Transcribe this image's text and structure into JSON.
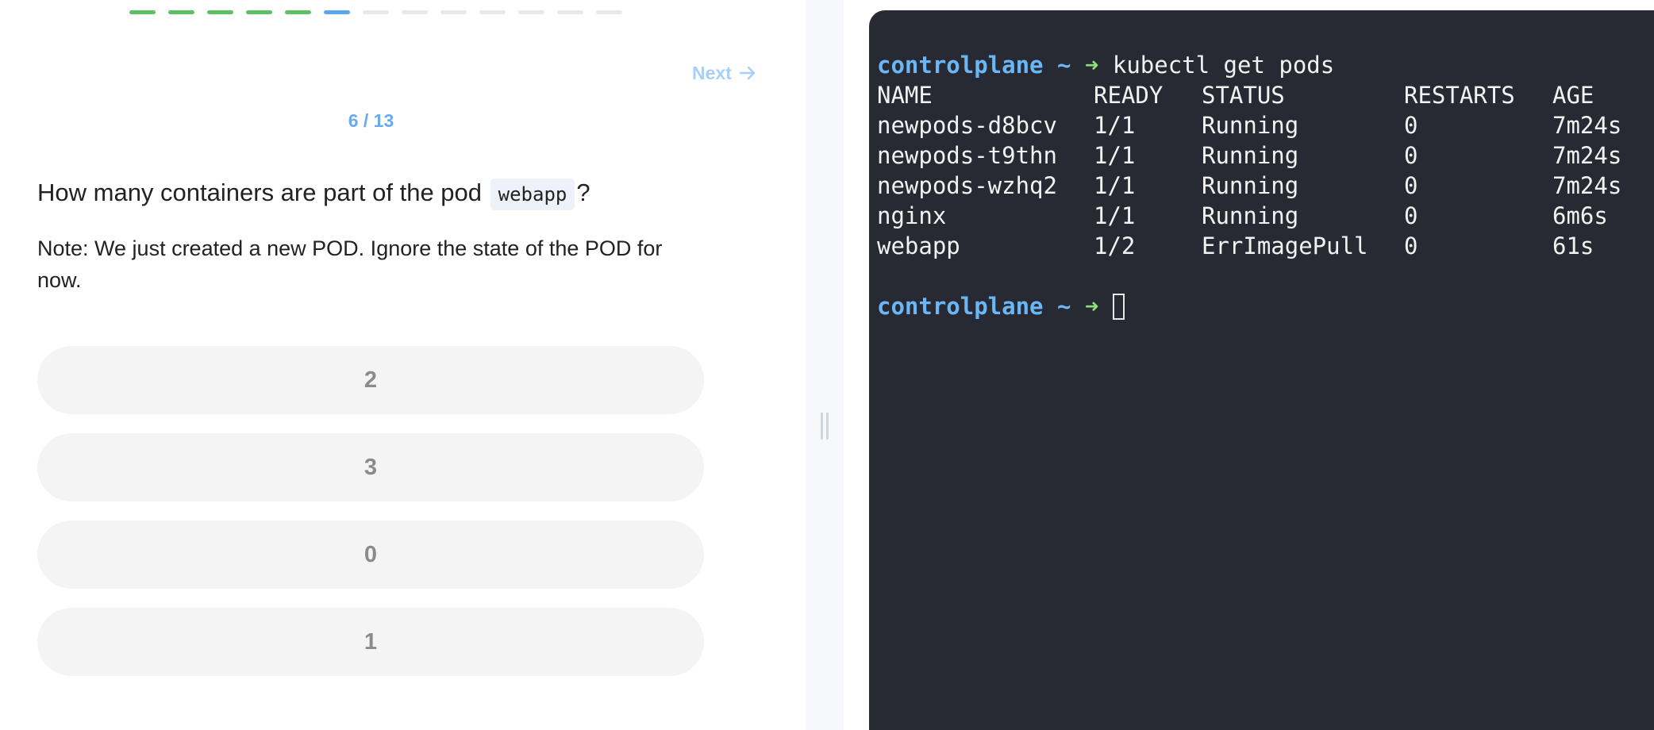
{
  "quiz": {
    "progress": {
      "total": 13,
      "completed": 5,
      "current": 6
    },
    "next_label": "Next",
    "counter": "6 / 13",
    "question": {
      "prefix": "How many containers are part of the pod",
      "code": "webapp",
      "suffix": "?"
    },
    "note": "Note: We just created a new POD. Ignore the state of the POD for now.",
    "options": [
      "2",
      "3",
      "0",
      "1"
    ],
    "colors": {
      "done": "#5cc164",
      "current": "#5aa6ef",
      "pending": "#e9e9e9"
    }
  },
  "terminal": {
    "prompt": {
      "host": "controlplane",
      "tilde": "~",
      "arrow": "➜"
    },
    "command": "kubectl get pods",
    "headers": [
      "NAME",
      "READY",
      "STATUS",
      "RESTARTS",
      "AGE"
    ],
    "rows": [
      [
        "newpods-d8bcv",
        "1/1",
        "Running",
        "0",
        "7m24s"
      ],
      [
        "newpods-t9thn",
        "1/1",
        "Running",
        "0",
        "7m24s"
      ],
      [
        "newpods-wzhq2",
        "1/1",
        "Running",
        "0",
        "7m24s"
      ],
      [
        "nginx",
        "1/1",
        "Running",
        "0",
        "6m6s"
      ],
      [
        "webapp",
        "1/2",
        "ErrImagePull",
        "0",
        "61s"
      ]
    ],
    "colors": {
      "background": "#282a33",
      "host": "#6bb6f5",
      "arrow": "#8fe07a"
    }
  }
}
